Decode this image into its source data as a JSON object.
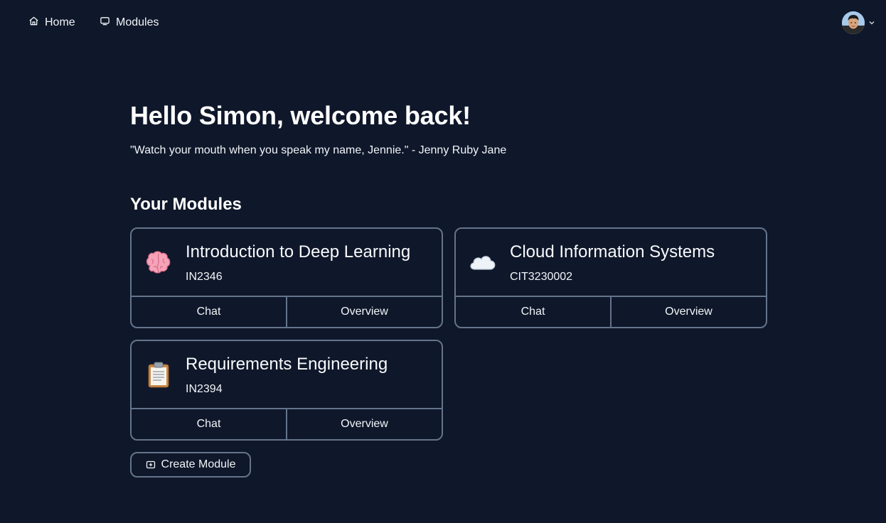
{
  "nav": {
    "home_label": "Home",
    "home_icon": "home-icon",
    "modules_label": "Modules",
    "modules_icon": "monitor-icon"
  },
  "user_menu": {
    "avatar_icon": "avatar",
    "chevron_icon": "chevron-down-icon"
  },
  "greeting": {
    "title": "Hello Simon, welcome back!",
    "quote": "\"Watch your mouth when you speak my name, Jennie.\" - Jenny Ruby Jane"
  },
  "modules": {
    "section_title": "Your Modules",
    "items": [
      {
        "emoji": "brain",
        "title": "Introduction to Deep Learning",
        "code": "IN2346",
        "chat_label": "Chat",
        "overview_label": "Overview"
      },
      {
        "emoji": "cloud",
        "title": "Cloud Information Systems",
        "code": "CIT3230002",
        "chat_label": "Chat",
        "overview_label": "Overview"
      },
      {
        "emoji": "clipboard",
        "title": "Requirements Engineering",
        "code": "IN2394",
        "chat_label": "Chat",
        "overview_label": "Overview"
      }
    ],
    "create_label": "Create Module",
    "create_icon": "add-box-icon"
  },
  "colors": {
    "background": "#0f172a",
    "border": "#64748b",
    "text": "#f1f5f9"
  }
}
